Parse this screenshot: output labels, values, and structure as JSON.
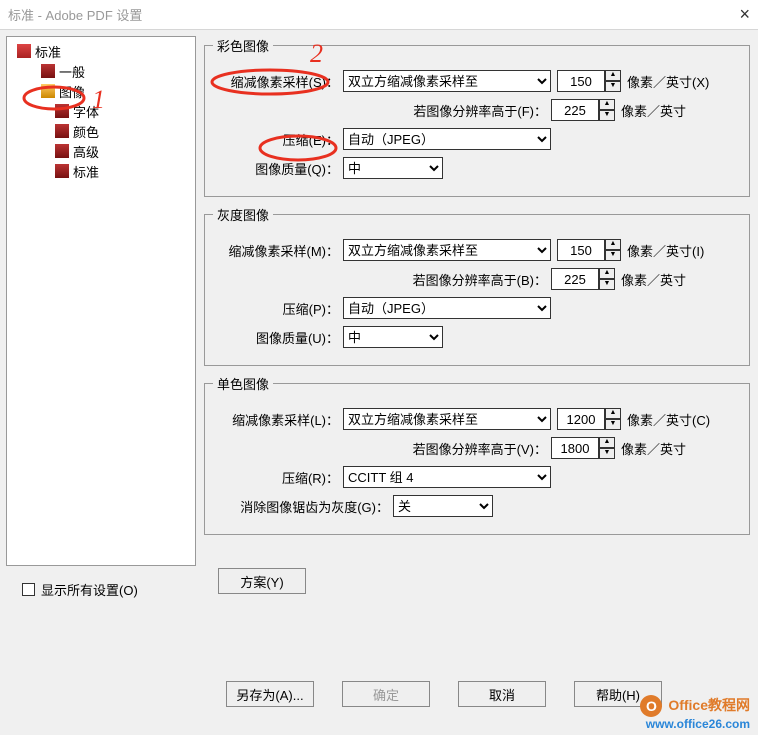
{
  "window": {
    "title": "标准 - Adobe PDF 设置",
    "close": "×"
  },
  "tree": {
    "root": "标准",
    "items": [
      "一般",
      "图像",
      "字体",
      "颜色",
      "高级",
      "标准"
    ],
    "selected_index": 1
  },
  "groups": {
    "color": {
      "legend": "彩色图像",
      "downsample_label": "缩减像素采样(S)：",
      "downsample_value": "双立方缩减像素采样至",
      "downsample_ppi": "150",
      "downsample_unit": "像素／英寸(X)",
      "above_label": "若图像分辨率高于(F)：",
      "above_value": "225",
      "above_unit": "像素／英寸",
      "compress_label": "压缩(E)：",
      "compress_value": "自动（JPEG）",
      "quality_label": "图像质量(Q)：",
      "quality_value": "中"
    },
    "gray": {
      "legend": "灰度图像",
      "downsample_label": "缩减像素采样(M)：",
      "downsample_value": "双立方缩减像素采样至",
      "downsample_ppi": "150",
      "downsample_unit": "像素／英寸(I)",
      "above_label": "若图像分辨率高于(B)：",
      "above_value": "225",
      "above_unit": "像素／英寸",
      "compress_label": "压缩(P)：",
      "compress_value": "自动（JPEG）",
      "quality_label": "图像质量(U)：",
      "quality_value": "中"
    },
    "mono": {
      "legend": "单色图像",
      "downsample_label": "缩减像素采样(L)：",
      "downsample_value": "双立方缩减像素采样至",
      "downsample_ppi": "1200",
      "downsample_unit": "像素／英寸(C)",
      "above_label": "若图像分辨率高于(V)：",
      "above_value": "1800",
      "above_unit": "像素／英寸",
      "compress_label": "压缩(R)：",
      "compress_value": "CCITT 组 4",
      "antialias_label": "消除图像锯齿为灰度(G)：",
      "antialias_value": "关"
    }
  },
  "scheme_button": "方案(Y)",
  "show_all": "显示所有设置(O)",
  "buttons": {
    "saveas": "另存为(A)...",
    "ok": "确定",
    "cancel": "取消",
    "help": "帮助(H)"
  },
  "annotations": {
    "one": "1",
    "two": "2"
  },
  "watermark": {
    "title": "Office教程网",
    "url": "www.office26.com"
  }
}
